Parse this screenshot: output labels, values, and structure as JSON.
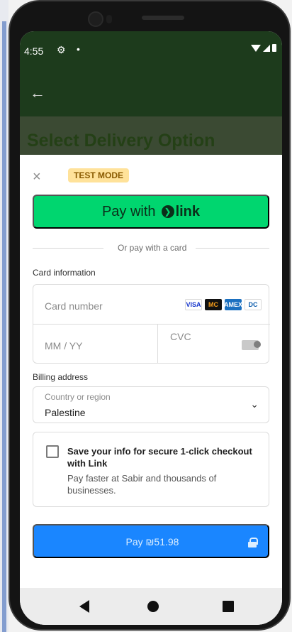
{
  "status_bar": {
    "time": "4:55",
    "gear_icon": "gear-icon",
    "dot": "•"
  },
  "app_bar": {
    "back_symbol": "←"
  },
  "page": {
    "title": "Select Delivery Option"
  },
  "sheet": {
    "close_symbol": "×",
    "test_mode_label": "TEST MODE",
    "link_button": {
      "prefix": "Pay with",
      "icon_symbol": "❯",
      "brand": "link"
    },
    "divider_text": "Or pay with a card",
    "card_information_label": "Card information",
    "card_number_placeholder": "Card number",
    "card_brands": [
      "VISA",
      "MC",
      "AMEX",
      "DC"
    ],
    "expiry_placeholder": "MM / YY",
    "cvc_placeholder": "CVC",
    "billing_address_label": "Billing address",
    "country_field_label": "Country or region",
    "country_value": "Palestine",
    "country_chevron_symbol": "⌄",
    "save_info_title": "Save your info for secure 1-click checkout with Link",
    "save_info_description": "Pay faster at Sabir and thousands of businesses.",
    "pay_button_label": "Pay ₪51.98"
  },
  "colors": {
    "header_green": "#1d3b1c",
    "link_green": "#00d66f",
    "pay_blue": "#1a86ff",
    "test_badge": "#ffe29a"
  },
  "icons": {
    "close": "close-icon",
    "back": "arrow-left-icon",
    "lock": "lock-icon",
    "chevron": "chevron-down-icon",
    "cvc": "cvc-card-icon"
  }
}
